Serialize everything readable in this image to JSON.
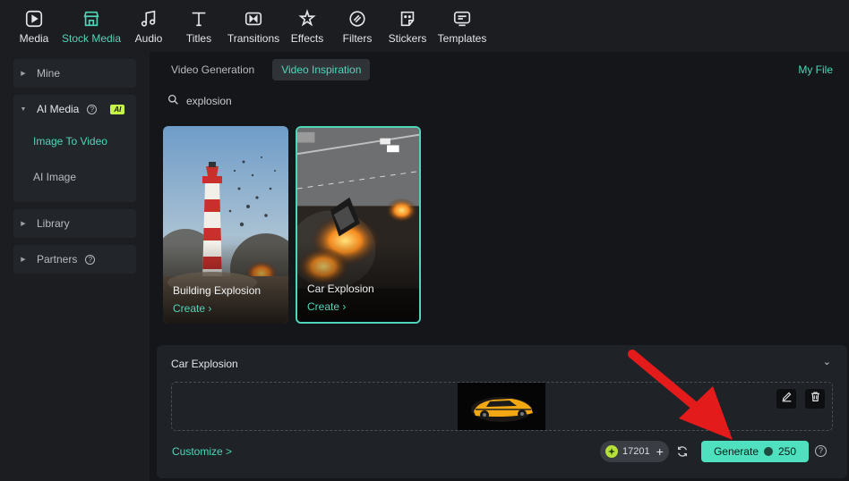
{
  "toolbar": {
    "items": [
      {
        "label": "Media",
        "icon": "media-icon"
      },
      {
        "label": "Stock Media",
        "icon": "stock-media-icon"
      },
      {
        "label": "Audio",
        "icon": "audio-icon"
      },
      {
        "label": "Titles",
        "icon": "titles-icon"
      },
      {
        "label": "Transitions",
        "icon": "transitions-icon"
      },
      {
        "label": "Effects",
        "icon": "effects-icon"
      },
      {
        "label": "Filters",
        "icon": "filters-icon"
      },
      {
        "label": "Stickers",
        "icon": "stickers-icon"
      },
      {
        "label": "Templates",
        "icon": "templates-icon"
      }
    ],
    "active": "Stock Media"
  },
  "sidebar": {
    "mine": "Mine",
    "ai_media": "AI Media",
    "ai_badge": "AI",
    "sub_items": [
      "Image To Video",
      "AI Image"
    ],
    "library": "Library",
    "partners": "Partners"
  },
  "main": {
    "tabs": [
      "Video Generation",
      "Video Inspiration"
    ],
    "active_tab": "Video Inspiration",
    "my_file": "My File",
    "search_value": "explosion",
    "cards": [
      {
        "title": "Building Explosion",
        "create": "Create"
      },
      {
        "title": "Car Explosion",
        "create": "Create"
      }
    ]
  },
  "panel": {
    "title": "Car Explosion",
    "customize": "Customize",
    "credits": "17201",
    "generate": "Generate",
    "cost": "250"
  },
  "colors": {
    "accent": "#4fd6b9",
    "generate_bg": "#4ee0bf",
    "ai_badge": "#c7f44a",
    "annotation_arrow": "#e31b1b"
  }
}
